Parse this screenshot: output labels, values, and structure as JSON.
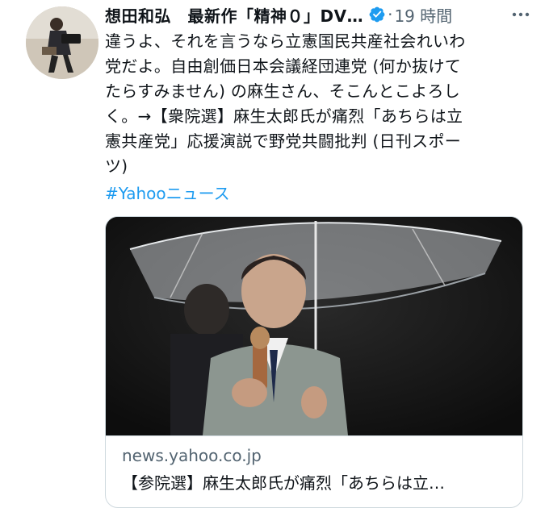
{
  "tweet": {
    "author_name": "想田和弘　最新作「精神０」DV…",
    "separator": "·",
    "timestamp": "19 時間",
    "lines": [
      "違うよ、それを言うなら立憲国民共産社会れいわ",
      "党だよ。自由創価日本会議経団連党 (何か抜けて",
      "たらすみません) の麻生さん、そこんとこよろし",
      "く。→【衆院選】麻生太郎氏が痛烈「あちらは立",
      "憲共産党」応援演説で野党共闘批判 (日刊スポー",
      "ツ)"
    ],
    "hashtag": "#Yahoo",
    "hashtag_suffix": "ニュース"
  },
  "card": {
    "domain": "news.yahoo.co.jp",
    "title": "【参院選】麻生太郎氏が痛烈「あちらは立…"
  },
  "icons": {
    "verified": "verified-badge-icon",
    "more": "more-options-icon"
  },
  "colors": {
    "link": "#1d9bf0",
    "muted": "#536471",
    "text": "#0f1419",
    "border": "#cfd9de"
  }
}
